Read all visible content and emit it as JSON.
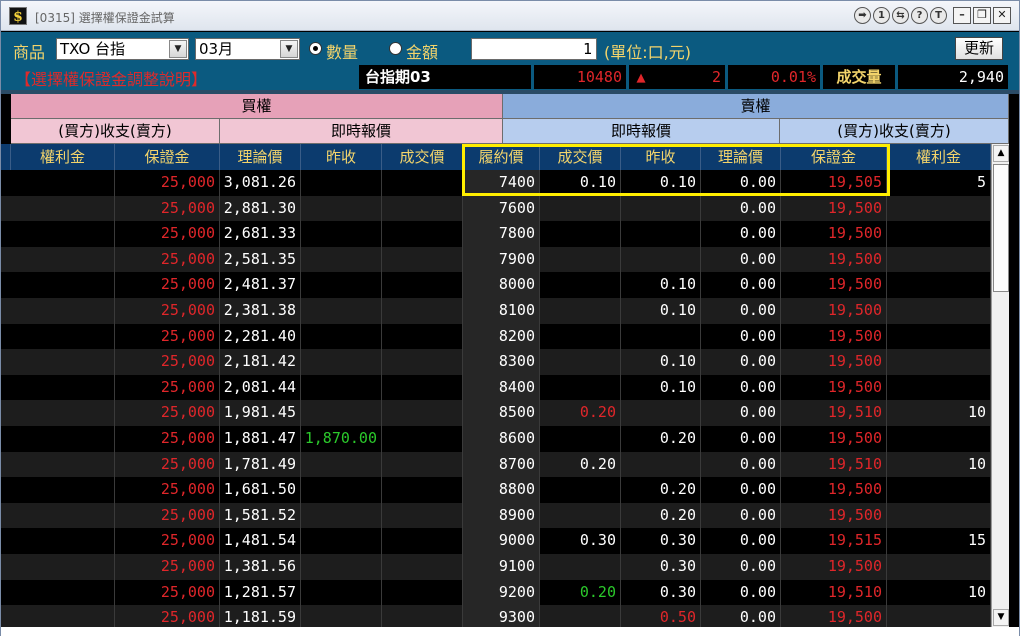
{
  "window": {
    "title": "[0315] 選擇權保證金試算",
    "buttons": [
      "➡",
      "1",
      "⇆",
      "?",
      "T"
    ],
    "min": "–",
    "max": "❐",
    "close": "✕"
  },
  "controls": {
    "product_label": "商品",
    "product_value": "TXO 台指",
    "month_value": "03月",
    "radio_qty": "數量",
    "radio_amount": "金額",
    "qty_value": "1",
    "unit_label": "(單位:口,元)",
    "refresh_label": "更新",
    "help_link": "【選擇權保證金調整說明】"
  },
  "futures": {
    "name": "台指期03",
    "price": "10480",
    "arrow": "▲",
    "change": "2",
    "pct": "0.01%",
    "volume_label": "成交量",
    "volume": "2,940"
  },
  "headers": {
    "call": "買權",
    "put": "賣權",
    "call_payout": "(買方)收支(賣方)",
    "call_quote": "即時報價",
    "put_quote": "即時報價",
    "put_payout": "(買方)收支(賣方)",
    "columns": [
      "權利金",
      "保證金",
      "理論價",
      "昨收",
      "成交價",
      "履約價",
      "成交價",
      "昨收",
      "理論價",
      "保證金",
      "權利金"
    ]
  },
  "rows": [
    {
      "c_prem": "",
      "c_margin": "25,000",
      "c_theo": "3,081.26",
      "c_prev": "",
      "c_last": "",
      "strike": "7400",
      "p_last": "0.10",
      "p_prev": "0.10",
      "p_theo": "0.00",
      "p_margin": "19,505",
      "p_prem": "5"
    },
    {
      "c_prem": "",
      "c_margin": "25,000",
      "c_theo": "2,881.30",
      "c_prev": "",
      "c_last": "",
      "strike": "7600",
      "p_last": "",
      "p_prev": "",
      "p_theo": "0.00",
      "p_margin": "19,500",
      "p_prem": ""
    },
    {
      "c_prem": "",
      "c_margin": "25,000",
      "c_theo": "2,681.33",
      "c_prev": "",
      "c_last": "",
      "strike": "7800",
      "p_last": "",
      "p_prev": "",
      "p_theo": "0.00",
      "p_margin": "19,500",
      "p_prem": ""
    },
    {
      "c_prem": "",
      "c_margin": "25,000",
      "c_theo": "2,581.35",
      "c_prev": "",
      "c_last": "",
      "strike": "7900",
      "p_last": "",
      "p_prev": "",
      "p_theo": "0.00",
      "p_margin": "19,500",
      "p_prem": ""
    },
    {
      "c_prem": "",
      "c_margin": "25,000",
      "c_theo": "2,481.37",
      "c_prev": "",
      "c_last": "",
      "strike": "8000",
      "p_last": "",
      "p_prev": "0.10",
      "p_theo": "0.00",
      "p_margin": "19,500",
      "p_prem": ""
    },
    {
      "c_prem": "",
      "c_margin": "25,000",
      "c_theo": "2,381.38",
      "c_prev": "",
      "c_last": "",
      "strike": "8100",
      "p_last": "",
      "p_prev": "0.10",
      "p_theo": "0.00",
      "p_margin": "19,500",
      "p_prem": ""
    },
    {
      "c_prem": "",
      "c_margin": "25,000",
      "c_theo": "2,281.40",
      "c_prev": "",
      "c_last": "",
      "strike": "8200",
      "p_last": "",
      "p_prev": "",
      "p_theo": "0.00",
      "p_margin": "19,500",
      "p_prem": ""
    },
    {
      "c_prem": "",
      "c_margin": "25,000",
      "c_theo": "2,181.42",
      "c_prev": "",
      "c_last": "",
      "strike": "8300",
      "p_last": "",
      "p_prev": "0.10",
      "p_theo": "0.00",
      "p_margin": "19,500",
      "p_prem": ""
    },
    {
      "c_prem": "",
      "c_margin": "25,000",
      "c_theo": "2,081.44",
      "c_prev": "",
      "c_last": "",
      "strike": "8400",
      "p_last": "",
      "p_prev": "0.10",
      "p_theo": "0.00",
      "p_margin": "19,500",
      "p_prem": ""
    },
    {
      "c_prem": "",
      "c_margin": "25,000",
      "c_theo": "1,981.45",
      "c_prev": "",
      "c_last": "",
      "strike": "8500",
      "p_last": "0.20",
      "p_last_color": "red",
      "p_prev": "",
      "p_theo": "0.00",
      "p_margin": "19,510",
      "p_prem": "10"
    },
    {
      "c_prem": "",
      "c_margin": "25,000",
      "c_theo": "1,881.47",
      "c_prev": "1,870.00",
      "c_prev_color": "green",
      "c_last": "",
      "strike": "8600",
      "p_last": "",
      "p_prev": "0.20",
      "p_theo": "0.00",
      "p_margin": "19,500",
      "p_prem": ""
    },
    {
      "c_prem": "",
      "c_margin": "25,000",
      "c_theo": "1,781.49",
      "c_prev": "",
      "c_last": "",
      "strike": "8700",
      "p_last": "0.20",
      "p_prev": "",
      "p_theo": "0.00",
      "p_margin": "19,510",
      "p_prem": "10"
    },
    {
      "c_prem": "",
      "c_margin": "25,000",
      "c_theo": "1,681.50",
      "c_prev": "",
      "c_last": "",
      "strike": "8800",
      "p_last": "",
      "p_prev": "0.20",
      "p_theo": "0.00",
      "p_margin": "19,500",
      "p_prem": ""
    },
    {
      "c_prem": "",
      "c_margin": "25,000",
      "c_theo": "1,581.52",
      "c_prev": "",
      "c_last": "",
      "strike": "8900",
      "p_last": "",
      "p_prev": "0.20",
      "p_theo": "0.00",
      "p_margin": "19,500",
      "p_prem": ""
    },
    {
      "c_prem": "",
      "c_margin": "25,000",
      "c_theo": "1,481.54",
      "c_prev": "",
      "c_last": "",
      "strike": "9000",
      "p_last": "0.30",
      "p_prev": "0.30",
      "p_theo": "0.00",
      "p_margin": "19,515",
      "p_prem": "15"
    },
    {
      "c_prem": "",
      "c_margin": "25,000",
      "c_theo": "1,381.56",
      "c_prev": "",
      "c_last": "",
      "strike": "9100",
      "p_last": "",
      "p_prev": "0.30",
      "p_theo": "0.00",
      "p_margin": "19,500",
      "p_prem": ""
    },
    {
      "c_prem": "",
      "c_margin": "25,000",
      "c_theo": "1,281.57",
      "c_prev": "",
      "c_last": "",
      "strike": "9200",
      "p_last": "0.20",
      "p_last_color": "green",
      "p_prev": "0.30",
      "p_theo": "0.00",
      "p_margin": "19,510",
      "p_prem": "10"
    },
    {
      "c_prem": "",
      "c_margin": "25,000",
      "c_theo": "1,181.59",
      "c_prev": "",
      "c_last": "",
      "strike": "9300",
      "p_last": "",
      "p_prev": "0.50",
      "p_prev_color": "red",
      "p_theo": "0.00",
      "p_margin": "19,500",
      "p_prem": ""
    }
  ],
  "colors": {
    "header_bar": "#0b5a80",
    "call_header": "#e6a1b8",
    "put_header": "#8aacdb",
    "column_header": "#0c3b6e",
    "label_yellow": "#f3d46b",
    "margin_red": "#e0262a",
    "highlight": "#ffee00"
  },
  "icons": {
    "app": "dollar-app-icon",
    "dropdown": "chevron-down-icon",
    "scroll_up": "arrow-up-icon",
    "scroll_down": "arrow-down-icon"
  }
}
